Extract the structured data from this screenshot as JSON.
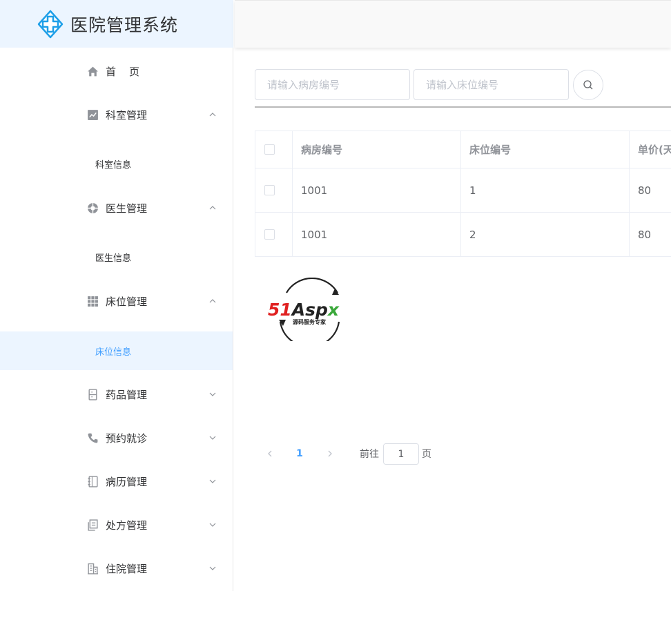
{
  "app": {
    "title": "医院管理系统",
    "brand_color": "#409eff",
    "icon": "medical-cross-icon"
  },
  "sidebar": {
    "active_color": "#409eff",
    "active_bg": "#ecf5ff",
    "items": [
      {
        "label": "首　页",
        "icon": "home-icon",
        "has_arrow": false
      },
      {
        "label": "科室管理",
        "icon": "chart-icon",
        "expanded": true,
        "children": [
          {
            "label": "科室信息",
            "active": false
          }
        ]
      },
      {
        "label": "医生管理",
        "icon": "aid-icon",
        "expanded": true,
        "children": [
          {
            "label": "医生信息",
            "active": false
          }
        ]
      },
      {
        "label": "床位管理",
        "icon": "grid-icon",
        "expanded": true,
        "children": [
          {
            "label": "床位信息",
            "active": true
          }
        ]
      },
      {
        "label": "药品管理",
        "icon": "cabinet-icon",
        "expanded": false
      },
      {
        "label": "预约就诊",
        "icon": "phone-icon",
        "expanded": false
      },
      {
        "label": "病历管理",
        "icon": "notebook-icon",
        "expanded": false
      },
      {
        "label": "处方管理",
        "icon": "document-icon",
        "expanded": false
      },
      {
        "label": "住院管理",
        "icon": "building-icon",
        "expanded": false
      }
    ]
  },
  "search": {
    "ward_placeholder": "请输入病房编号",
    "bed_placeholder": "请输入床位编号",
    "button_icon": "search-icon"
  },
  "table": {
    "columns": [
      "病房编号",
      "床位编号",
      "单价(天)"
    ],
    "rows": [
      [
        "1001",
        "1",
        "80"
      ],
      [
        "1001",
        "2",
        "80"
      ]
    ]
  },
  "watermark": {
    "main_text": "51Aspx",
    "sub_text": "源码服务专家"
  },
  "pagination": {
    "current_page": "1",
    "goto_label": "前往",
    "goto_value": "1",
    "page_suffix": "页"
  }
}
